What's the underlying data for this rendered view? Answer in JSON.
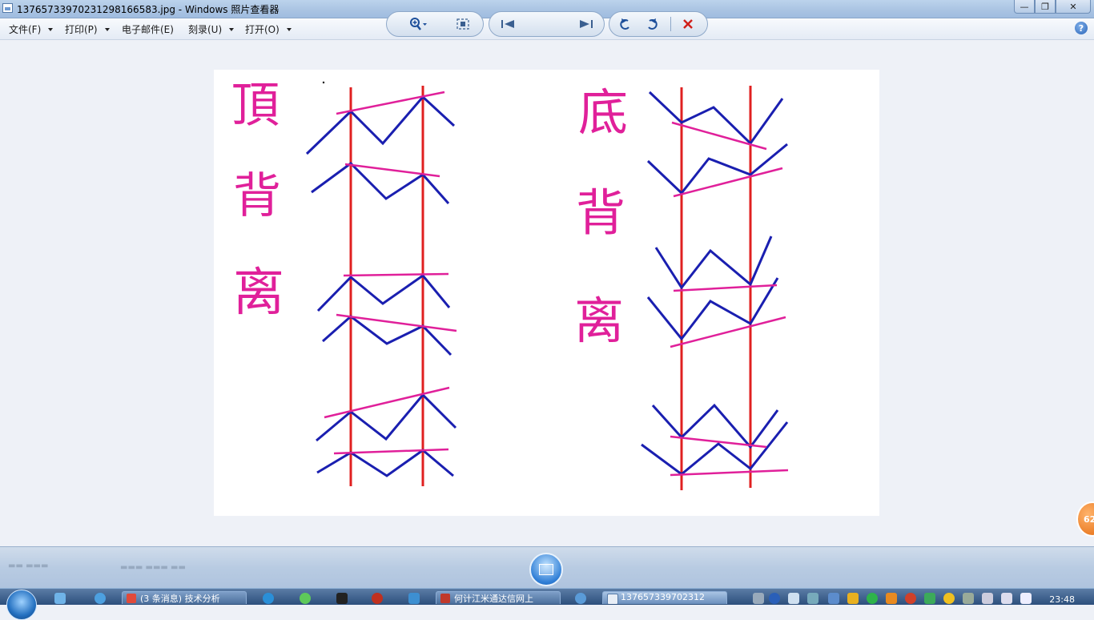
{
  "window": {
    "title": "1376573397023129816​6583.jpg - Windows 照片查看器",
    "buttons": {
      "minimize": "—",
      "maximize": "❐",
      "close": "✕"
    }
  },
  "menu": {
    "file": "文件(F)",
    "print": "打印(P)",
    "email": "电子邮件(E)",
    "burn": "刻录(U)",
    "open": "打开(O)",
    "help": "?"
  },
  "image": {
    "left_text": [
      "頂",
      "背",
      "离"
    ],
    "right_text": [
      "底",
      "背",
      "离"
    ],
    "colors": {
      "red": "#e02020",
      "blue": "#1a1fb0",
      "magenta": "#e0209a"
    }
  },
  "side_badge": "62",
  "controls": {
    "zoom_icon": "zoom-icon",
    "fit_icon": "actual-size-icon",
    "prev_icon": "previous-icon",
    "slideshow_icon": "slideshow-icon",
    "next_icon": "next-icon",
    "rotate_ccw_icon": "rotate-counterclockwise-icon",
    "rotate_cw_icon": "rotate-clockwise-icon",
    "delete_icon": "delete-icon"
  },
  "taskbar": {
    "tasks": [
      {
        "label": "(3 条消息) 技术分析",
        "active": false
      },
      {
        "label": "何计江米通达信网上",
        "active": false
      },
      {
        "label": "137657339702312",
        "active": true
      }
    ],
    "clock": "23:48"
  }
}
